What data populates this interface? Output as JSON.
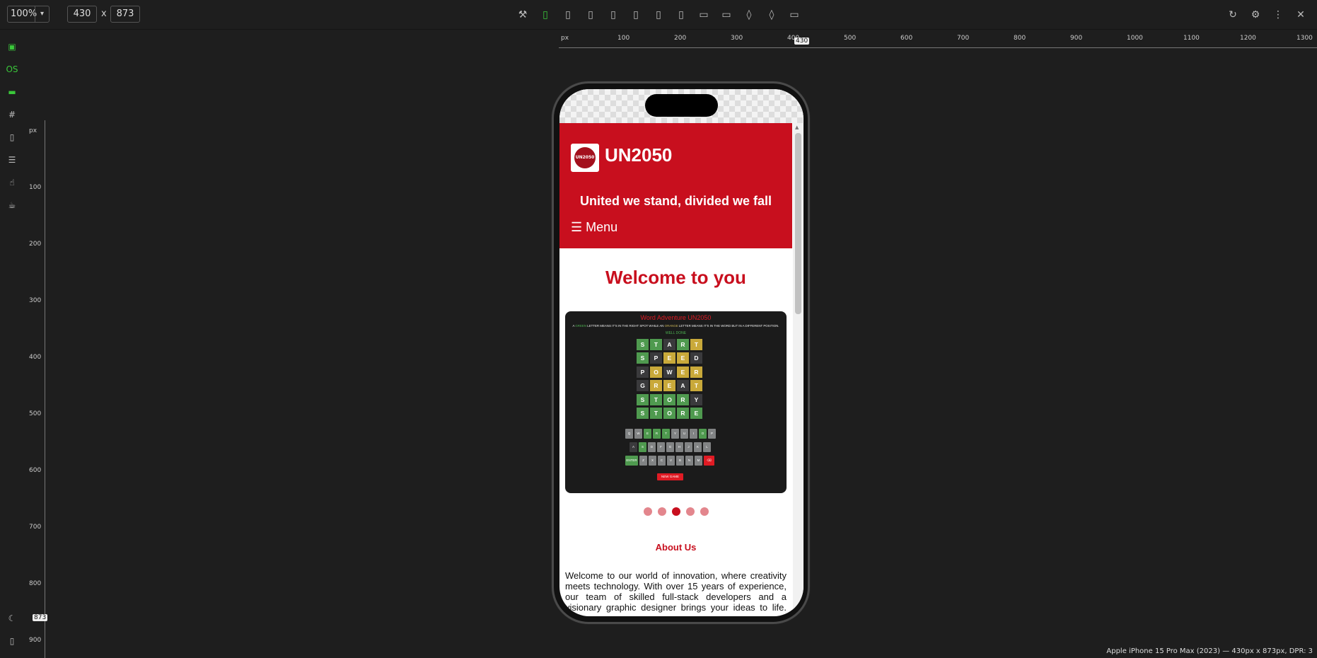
{
  "toolbar": {
    "zoom": "100%",
    "width": "430",
    "height": "873",
    "x_label": "x",
    "device_icons": [
      "tools-icon",
      "phone-icon",
      "phone-icon",
      "phone-icon",
      "phone-icon",
      "tablet-icon",
      "tablet-icon",
      "tablet-icon",
      "laptop-icon",
      "laptop-icon",
      "watch-icon",
      "watch-icon",
      "desktop-icon"
    ],
    "right_icons": [
      "refresh-icon",
      "gear-icon",
      "more-icon",
      "close-icon"
    ]
  },
  "sidebar": {
    "items": [
      {
        "icon": "devices-icon",
        "label": ""
      },
      {
        "icon": "os-icon",
        "label": "OS"
      },
      {
        "icon": "ruler-icon",
        "label": ""
      },
      {
        "icon": "grid-icon",
        "label": ""
      },
      {
        "icon": "screenshot-icon",
        "label": ""
      },
      {
        "icon": "list-icon",
        "label": ""
      },
      {
        "icon": "touch-icon",
        "label": ""
      },
      {
        "icon": "coffee-icon",
        "label": ""
      }
    ]
  },
  "ruler": {
    "unit": "px",
    "h_labels": [
      "100",
      "200",
      "300",
      "400",
      "500",
      "600",
      "700",
      "800",
      "900",
      "1000",
      "1100",
      "1200",
      "1300"
    ],
    "v_labels": [
      "100",
      "200",
      "300",
      "400",
      "500",
      "600",
      "700",
      "800",
      "900"
    ],
    "h_marker": "430",
    "v_marker": "873"
  },
  "site": {
    "brand": "UN2050",
    "logo_text": "UN2050",
    "tagline": "United we stand, divided we fall",
    "menu": "☰ Menu",
    "welcome": "Welcome to you",
    "about_title": "About Us",
    "about_text": "Welcome to our world of innovation, where creativity meets technology. With over 15 years of experience, our team of skilled full-stack developers and a visionary graphic designer brings your ideas to life. We"
  },
  "game": {
    "title": "Word Adventure UN2050",
    "instr_a": "A",
    "instr_green": "GREEN",
    "instr_b": "LETTER MEANS IT'S IN THE RIGHT SPOT WHILE AN",
    "instr_yellow": "ORANGE",
    "instr_c": "LETTER MEANS IT'S IN THE WORD BUT IN A DIFFERENT POSITION.",
    "status": "WELL DONE",
    "new_game": "NEW GAME",
    "rows": [
      [
        [
          "S",
          "g"
        ],
        [
          "T",
          "g"
        ],
        [
          "A",
          "d"
        ],
        [
          "R",
          "g"
        ],
        [
          "T",
          "y"
        ]
      ],
      [
        [
          "S",
          "g"
        ],
        [
          "P",
          "d"
        ],
        [
          "E",
          "y"
        ],
        [
          "E",
          "y"
        ],
        [
          "D",
          "d"
        ]
      ],
      [
        [
          "P",
          "d"
        ],
        [
          "O",
          "y"
        ],
        [
          "W",
          "d"
        ],
        [
          "E",
          "y"
        ],
        [
          "R",
          "y"
        ]
      ],
      [
        [
          "G",
          "d"
        ],
        [
          "R",
          "y"
        ],
        [
          "E",
          "y"
        ],
        [
          "A",
          "d"
        ],
        [
          "T",
          "y"
        ]
      ],
      [
        [
          "S",
          "g"
        ],
        [
          "T",
          "g"
        ],
        [
          "O",
          "g"
        ],
        [
          "R",
          "g"
        ],
        [
          "Y",
          "d"
        ]
      ],
      [
        [
          "S",
          "g"
        ],
        [
          "T",
          "g"
        ],
        [
          "O",
          "g"
        ],
        [
          "R",
          "g"
        ],
        [
          "E",
          "g"
        ]
      ]
    ],
    "keyboard": [
      [
        [
          "Q",
          "k"
        ],
        [
          "W",
          "k"
        ],
        [
          "E",
          "g"
        ],
        [
          "R",
          "g"
        ],
        [
          "T",
          "g"
        ],
        [
          "Y",
          "k"
        ],
        [
          "U",
          "k"
        ],
        [
          "I",
          "k"
        ],
        [
          "O",
          "g"
        ],
        [
          "P",
          "k"
        ]
      ],
      [
        [
          "A",
          "d"
        ],
        [
          "S",
          "g"
        ],
        [
          "D",
          "k"
        ],
        [
          "F",
          "k"
        ],
        [
          "G",
          "k"
        ],
        [
          "H",
          "k"
        ],
        [
          "J",
          "k"
        ],
        [
          "K",
          "k"
        ],
        [
          "L",
          "k"
        ]
      ],
      [
        [
          "ENTER",
          "g"
        ],
        [
          "Z",
          "k"
        ],
        [
          "X",
          "k"
        ],
        [
          "C",
          "k"
        ],
        [
          "V",
          "k"
        ],
        [
          "B",
          "k"
        ],
        [
          "N",
          "k"
        ],
        [
          "M",
          "k"
        ],
        [
          "⌫",
          "r"
        ]
      ]
    ],
    "colors": {
      "g": "#4f9a4f",
      "y": "#c9a93a",
      "d": "#3a3a3c",
      "k": "#818384",
      "r": "#e01b24"
    }
  },
  "carousel": {
    "dots": 5,
    "active": 3
  },
  "footer": "Apple iPhone 15 Pro Max (2023) — 430px x 873px, DPR: 3"
}
